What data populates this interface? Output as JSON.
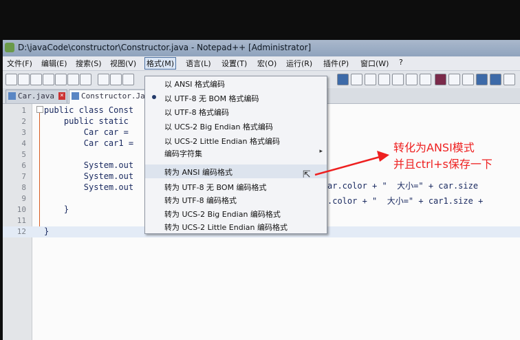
{
  "window": {
    "title": "D:\\javaCode\\constructor\\Constructor.java - Notepad++ [Administrator]"
  },
  "menubar": {
    "items": [
      "文件(F)",
      "编辑(E)",
      "搜索(S)",
      "视图(V)",
      "格式(M)",
      "语言(L)",
      "设置(T)",
      "宏(O)",
      "运行(R)",
      "插件(P)",
      "窗口(W)",
      "?"
    ]
  },
  "tabs": [
    {
      "label": "Car.java"
    },
    {
      "label": "Constructor.Ja"
    }
  ],
  "editor": {
    "lines": [
      {
        "num": "1",
        "code": "public class Const",
        "tail": ""
      },
      {
        "num": "2",
        "code": "    public static",
        "tail": ""
      },
      {
        "num": "3",
        "code": "        Car car =",
        "tail": ""
      },
      {
        "num": "4",
        "code": "        Car car1 =",
        "tail": ""
      },
      {
        "num": "5",
        "code": "",
        "tail": ""
      },
      {
        "num": "6",
        "code": "        System.out",
        "tail": ""
      },
      {
        "num": "7",
        "code": "        System.out",
        "tail": ""
      },
      {
        "num": "8",
        "code": "        System.out",
        "tail": "ar.color + \"  大小=\" + car.size"
      },
      {
        "num": "9",
        "code": "",
        "tail": ".color + \"  大小=\" + car1.size +"
      },
      {
        "num": "10",
        "code": "    }",
        "tail": ""
      },
      {
        "num": "11",
        "code": "",
        "tail": ""
      },
      {
        "num": "12",
        "code": "}",
        "tail": ""
      }
    ]
  },
  "format_menu": {
    "items": [
      {
        "label": "以 ANSI 格式编码",
        "checked": false
      },
      {
        "label": "以 UTF-8 无 BOM 格式编码",
        "checked": true
      },
      {
        "label": "以 UTF-8 格式编码",
        "checked": false
      },
      {
        "label": "以 UCS-2 Big Endian 格式编码",
        "checked": false
      },
      {
        "label": "以 UCS-2 Little Endian 格式编码",
        "checked": false
      },
      {
        "label": "编码字符集",
        "checked": false,
        "submenu": true
      },
      {
        "label": "转为 ANSI 编码格式",
        "checked": false,
        "hover": true
      },
      {
        "label": "转为 UTF-8 无 BOM 编码格式",
        "checked": false
      },
      {
        "label": "转为 UTF-8 编码格式",
        "checked": false
      },
      {
        "label": "转为 UCS-2 Big Endian 编码格式",
        "checked": false
      },
      {
        "label": "转为 UCS-2 Little Endian 编码格式",
        "checked": false
      }
    ]
  },
  "annotation": {
    "line1": "转化为ANSI模式",
    "line2": "并且ctrl+s保存一下",
    "color": "#ee2020"
  },
  "icons": [
    "notepadpp-app-icon",
    "java-file-icon",
    "close-icon",
    "submenu-arrow-icon",
    "mouse-cursor-icon",
    "arrow-annotation"
  ]
}
